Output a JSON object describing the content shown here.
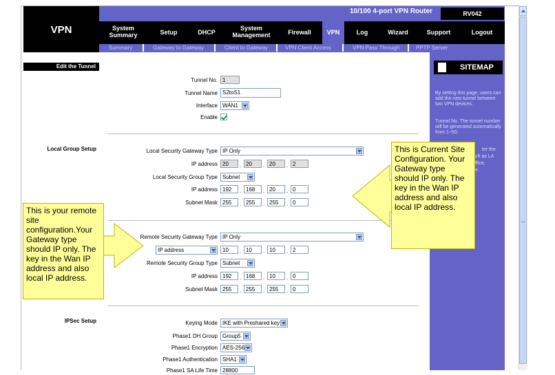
{
  "header": {
    "section_title": "VPN",
    "product_name": "10/100 4-port VPN Router",
    "model": "RV042",
    "nav": [
      "System Summary",
      "Setup",
      "DHCP",
      "System Management",
      "Firewall",
      "VPN",
      "Log",
      "Wizard",
      "Support",
      "Logout"
    ],
    "subnav": [
      "Summary",
      "Gateway to Gateway",
      "Client to Gateway",
      "VPN Client Access",
      "VPN Pass Through",
      "PPTP Server"
    ]
  },
  "left": {
    "edit_tunnel": "Edit the Tunnel",
    "local_group_setup": "Local Group Setup",
    "ipsec_setup": "IPSec Setup"
  },
  "tunnel": {
    "tunnel_no_label": "Tunnel No.",
    "tunnel_no": "1",
    "tunnel_name_label": "Tunnel Name",
    "tunnel_name": "S2toS1",
    "interface_label": "Interface",
    "interface": "WAN1",
    "enable_label": "Enable"
  },
  "local": {
    "gw_type_label": "Local Security Gateway Type",
    "gw_type": "IP Only",
    "ip_label": "IP address",
    "ip": [
      "20",
      "20",
      "20",
      "2"
    ],
    "group_type_label": "Local Security Group Type",
    "group_type": "Subnet",
    "group_ip_label": "IP address",
    "group_ip": [
      "192",
      "168",
      "20",
      "0"
    ],
    "mask_label": "Subnet Mask",
    "mask": [
      "255",
      "255",
      "255",
      "0"
    ]
  },
  "remote": {
    "gw_type_label": "Remote Security Gateway Type",
    "gw_type": "IP Only",
    "addr_sel": "IP address",
    "ip": [
      "10",
      "10",
      "10",
      "2"
    ],
    "group_type_label": "Remote Security Group Type",
    "group_type": "Subnet",
    "group_ip_label": "IP address",
    "group_ip": [
      "192",
      "168",
      "10",
      "0"
    ],
    "mask_label": "Subnet Mask",
    "mask": [
      "255",
      "255",
      "255",
      "0"
    ]
  },
  "ipsec": {
    "keying_label": "Keying Mode",
    "keying": "IKE with Preshared key",
    "dh_label": "Phase1 DH Group",
    "dh": "Group5",
    "enc_label": "Phase1 Encryption",
    "enc": "AES-256",
    "auth_label": "Phase1 Authentication",
    "auth": "SHA1",
    "sa_label": "Phase1 SA Life Time",
    "sa": "28800"
  },
  "sidebar": {
    "sitemap": "SITEMAP",
    "help1": "By setting this page, users can add the new tunnel between two VPN devices.",
    "help2": "Tunnel No. The tunnel number will be generated automatically from 1~50.",
    "help3_frag1": "ter the",
    "help3_frag2": "ch as LA",
    "help3_frag3": "ffice,",
    "help3_frag4": "e."
  },
  "callouts": {
    "right": "This is Current Site Configuration. Your Gateway type should IP only. The key in the Wan IP address and also local IP address.",
    "left": "This is your remote site configuration.Your Gateway type should IP only. The key in the Wan IP address and also local IP address."
  },
  "colors": {
    "purple": "#6464c8",
    "callout": "#ffff99"
  }
}
